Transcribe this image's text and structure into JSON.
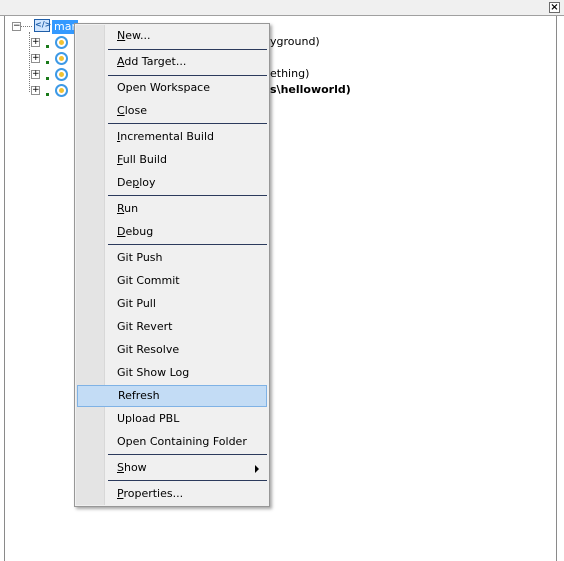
{
  "window": {
    "close_glyph": "×"
  },
  "tree": {
    "root_label": "mar",
    "rows": [
      {
        "text": "yground)"
      },
      {
        "text": ""
      },
      {
        "text": "ething)"
      },
      {
        "text": "s\\helloworld)"
      }
    ]
  },
  "context_menu": {
    "items": [
      {
        "label": "New...",
        "mnemonic": "N",
        "rest": "ew..."
      },
      {
        "label": "Add Target...",
        "mnemonic": "A",
        "rest": "dd Target..."
      },
      {
        "label": "Open Workspace"
      },
      {
        "label": "Close",
        "mnemonic": "C",
        "rest": "lose"
      },
      {
        "label": "Incremental Build",
        "mnemonic": "I",
        "rest": "ncremental Build"
      },
      {
        "label": "Full Build",
        "mnemonic": "F",
        "rest": "ull Build"
      },
      {
        "label": "Deploy",
        "pre": "De",
        "mnemonic": "p",
        "rest": "loy"
      },
      {
        "label": "Run",
        "mnemonic": "R",
        "rest": "un"
      },
      {
        "label": "Debug",
        "mnemonic": "D",
        "rest": "ebug"
      },
      {
        "label": "Git Push"
      },
      {
        "label": "Git Commit"
      },
      {
        "label": "Git Pull"
      },
      {
        "label": "Git Revert"
      },
      {
        "label": "Git Resolve"
      },
      {
        "label": "Git Show Log"
      },
      {
        "label": "Refresh",
        "highlighted": true
      },
      {
        "label": "Upload PBL"
      },
      {
        "label": "Open Containing Folder"
      },
      {
        "label": "Show",
        "mnemonic": "S",
        "rest": "how",
        "submenu": true
      },
      {
        "label": "Properties...",
        "mnemonic": "P",
        "rest": "roperties..."
      }
    ]
  },
  "colors": {
    "selection": "#3399ff",
    "menu_highlight": "#c3dcf5",
    "menu_bg": "#f0f0f0"
  }
}
